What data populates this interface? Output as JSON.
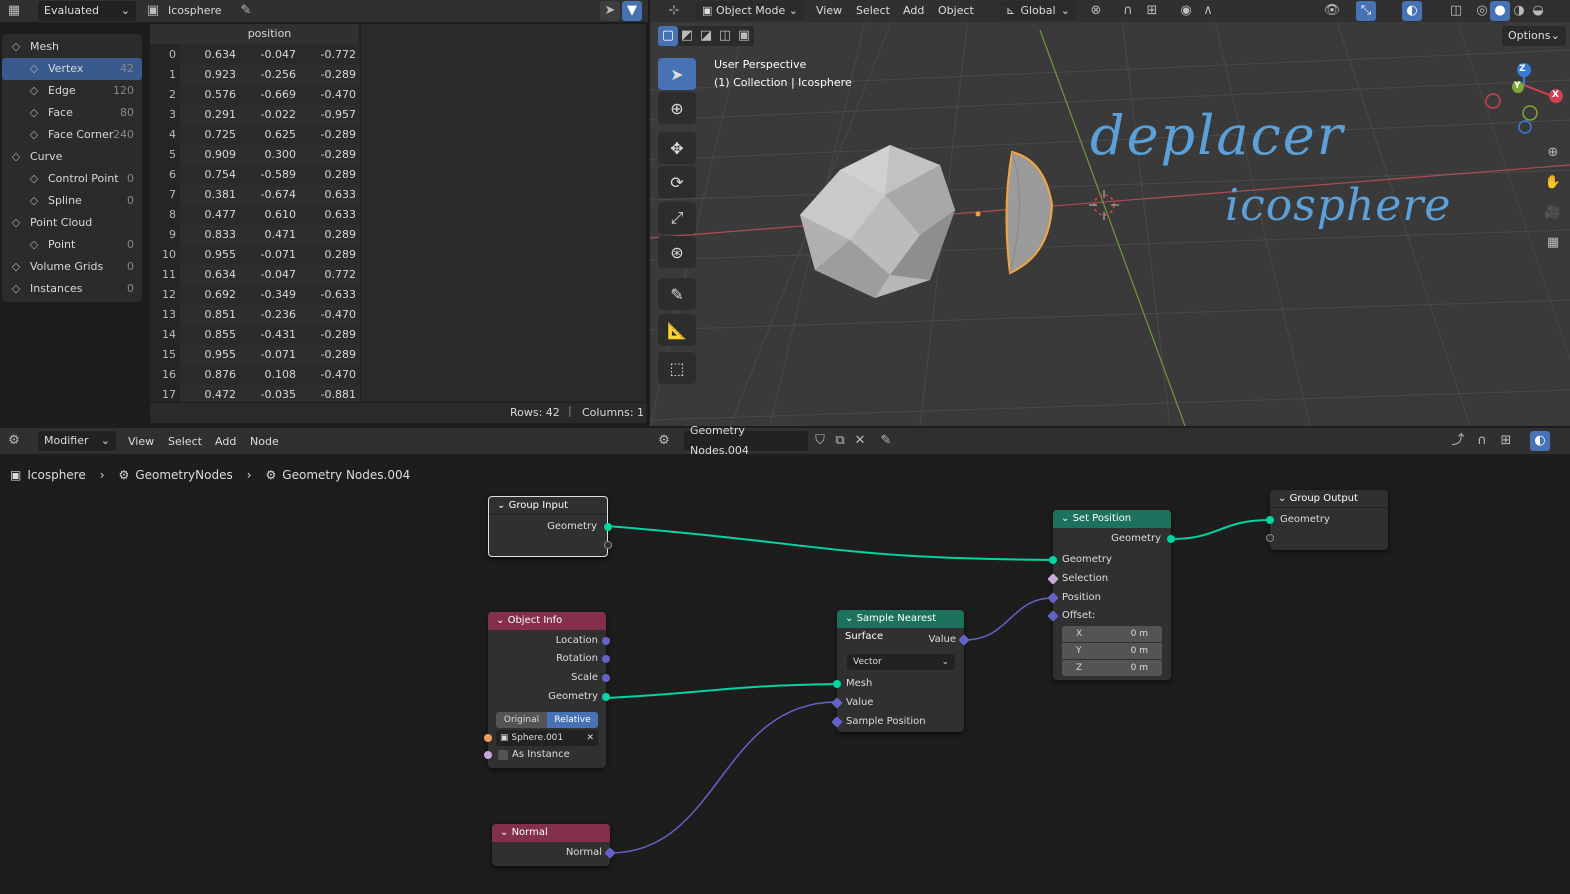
{
  "spreadsheet": {
    "mode": "Evaluated",
    "object": "Icosphere",
    "column_header": "position",
    "domains": [
      {
        "label": "Mesh",
        "count": "",
        "icon": "mesh-icon",
        "indent": 0
      },
      {
        "label": "Vertex",
        "count": "42",
        "icon": "vertex-icon",
        "indent": 1,
        "selected": true
      },
      {
        "label": "Edge",
        "count": "120",
        "icon": "edge-icon",
        "indent": 1
      },
      {
        "label": "Face",
        "count": "80",
        "icon": "face-icon",
        "indent": 1
      },
      {
        "label": "Face Corner",
        "count": "240",
        "icon": "face-corner-icon",
        "indent": 1
      },
      {
        "label": "Curve",
        "count": "",
        "icon": "curve-icon",
        "indent": 0
      },
      {
        "label": "Control Point",
        "count": "0",
        "icon": "control-point-icon",
        "indent": 1
      },
      {
        "label": "Spline",
        "count": "0",
        "icon": "spline-icon",
        "indent": 1
      },
      {
        "label": "Point Cloud",
        "count": "",
        "icon": "point-cloud-icon",
        "indent": 0
      },
      {
        "label": "Point",
        "count": "0",
        "icon": "point-icon",
        "indent": 1
      },
      {
        "label": "Volume Grids",
        "count": "0",
        "icon": "volume-icon",
        "indent": 0
      },
      {
        "label": "Instances",
        "count": "0",
        "icon": "instances-icon",
        "indent": 0
      }
    ],
    "rows": [
      [
        "0",
        "0.634",
        "-0.047",
        "-0.772"
      ],
      [
        "1",
        "0.923",
        "-0.256",
        "-0.289"
      ],
      [
        "2",
        "0.576",
        "-0.669",
        "-0.470"
      ],
      [
        "3",
        "0.291",
        "-0.022",
        "-0.957"
      ],
      [
        "4",
        "0.725",
        "0.625",
        "-0.289"
      ],
      [
        "5",
        "0.909",
        "0.300",
        "-0.289"
      ],
      [
        "6",
        "0.754",
        "-0.589",
        "0.289"
      ],
      [
        "7",
        "0.381",
        "-0.674",
        "0.633"
      ],
      [
        "8",
        "0.477",
        "0.610",
        "0.633"
      ],
      [
        "9",
        "0.833",
        "0.471",
        "0.289"
      ],
      [
        "10",
        "0.955",
        "-0.071",
        "0.289"
      ],
      [
        "11",
        "0.634",
        "-0.047",
        "0.772"
      ],
      [
        "12",
        "0.692",
        "-0.349",
        "-0.633"
      ],
      [
        "13",
        "0.851",
        "-0.236",
        "-0.470"
      ],
      [
        "14",
        "0.855",
        "-0.431",
        "-0.289"
      ],
      [
        "15",
        "0.955",
        "-0.071",
        "-0.289"
      ],
      [
        "16",
        "0.876",
        "0.108",
        "-0.470"
      ],
      [
        "17",
        "0.472",
        "-0.035",
        "-0.881"
      ]
    ],
    "footer_rows": "Rows: 42",
    "footer_columns": "Columns: 1"
  },
  "viewport": {
    "mode": "Object Mode",
    "menus": [
      "View",
      "Select",
      "Add",
      "Object"
    ],
    "orientation": "Global",
    "options": "Options",
    "perspective_label": "User Perspective",
    "collection_label": "(1) Collection | Icosphere",
    "handwriting_line1": "deplacer",
    "handwriting_line2": "icosphere",
    "gizmo_x": "X",
    "gizmo_y": "Y",
    "gizmo_z": "Z"
  },
  "node_editor": {
    "editor_type": "Modifier",
    "menus": [
      "View",
      "Select",
      "Add",
      "Node"
    ],
    "node_group": "Geometry Nodes.004",
    "breadcrumb": [
      "Icosphere",
      "GeometryNodes",
      "Geometry Nodes.004"
    ],
    "nodes": {
      "group_input": {
        "title": "Group Input",
        "geometry": "Geometry"
      },
      "group_output": {
        "title": "Group Output",
        "geometry": "Geometry"
      },
      "object_info": {
        "title": "Object Info",
        "location": "Location",
        "rotation": "Rotation",
        "scale": "Scale",
        "geometry": "Geometry",
        "original": "Original",
        "relative": "Relative",
        "object": "Sphere.001",
        "as_instance": "As Instance"
      },
      "normal": {
        "title": "Normal",
        "normal": "Normal"
      },
      "sample_nearest_surface": {
        "title": "Sample Nearest Surface",
        "value_out": "Value",
        "type": "Vector",
        "mesh": "Mesh",
        "value_in": "Value",
        "sample_position": "Sample Position"
      },
      "set_position": {
        "title": "Set Position",
        "geometry_out": "Geometry",
        "geometry_in": "Geometry",
        "selection": "Selection",
        "position": "Position",
        "offset": "Offset:",
        "x_label": "X",
        "x_value": "0 m",
        "y_label": "Y",
        "y_value": "0 m",
        "z_label": "Z",
        "z_value": "0 m"
      }
    }
  },
  "colors": {
    "geometry_socket": "#00d6a3",
    "vector_socket": "#6363c7",
    "object_header": "#83314a",
    "geometry_header": "#1d725e",
    "selection_blue": "#4772b3",
    "active_outline": "#f5a442"
  }
}
